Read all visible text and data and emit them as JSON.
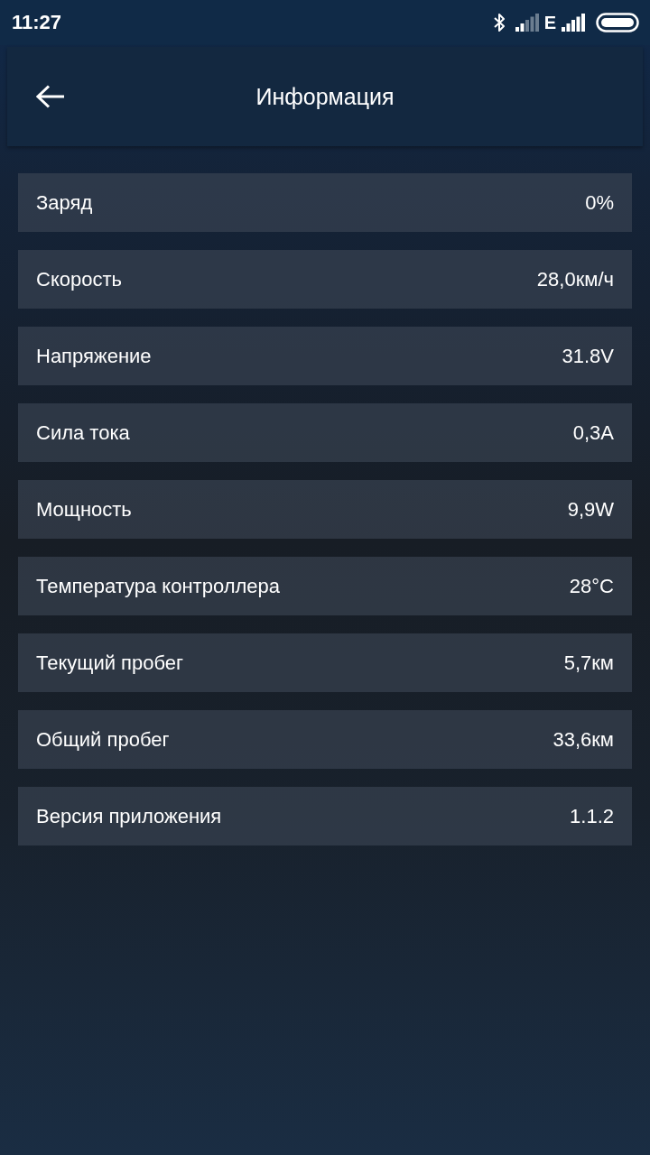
{
  "status_bar": {
    "time": "11:27",
    "network_type": "E"
  },
  "header": {
    "title": "Информация"
  },
  "info_rows": [
    {
      "label": "Заряд",
      "value": "0%"
    },
    {
      "label": "Скорость",
      "value": "28,0км/ч"
    },
    {
      "label": "Напряжение",
      "value": "31.8V"
    },
    {
      "label": "Сила тока",
      "value": "0,3A"
    },
    {
      "label": "Мощность",
      "value": "9,9W"
    },
    {
      "label": "Температура контроллера",
      "value": "28°C"
    },
    {
      "label": "Текущий пробег",
      "value": "5,7км"
    },
    {
      "label": "Общий пробег",
      "value": "33,6км"
    },
    {
      "label": "Версия приложения",
      "value": "1.1.2"
    }
  ]
}
